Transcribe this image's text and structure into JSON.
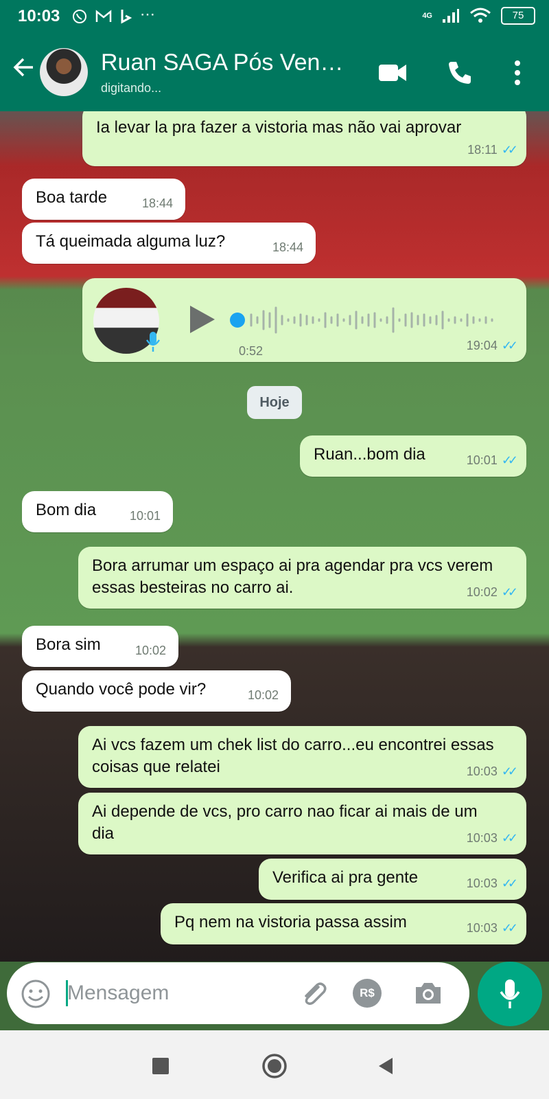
{
  "status_bar": {
    "time": "10:03",
    "network": "4G",
    "battery": "75"
  },
  "header": {
    "contact_name": "Ruan SAGA Pós Ven…",
    "status": "digitando..."
  },
  "messages": [
    {
      "dir": "out",
      "text": "Ia levar la pra fazer a vistoria mas não vai aprovar",
      "time": "18:11"
    },
    {
      "dir": "in",
      "text": "Boa tarde",
      "time": "18:44"
    },
    {
      "dir": "in",
      "text": "Tá queimada alguma luz?",
      "time": "18:44"
    },
    {
      "dir": "out",
      "type": "voice",
      "duration": "0:52",
      "time": "19:04"
    },
    {
      "dir": "out",
      "text": "Ruan...bom dia",
      "time": "10:01"
    },
    {
      "dir": "in",
      "text": "Bom dia",
      "time": "10:01"
    },
    {
      "dir": "out",
      "text": "Bora arrumar um espaço ai pra agendar pra vcs verem essas besteiras no carro ai.",
      "time": "10:02"
    },
    {
      "dir": "in",
      "text": "Bora sim",
      "time": "10:02"
    },
    {
      "dir": "in",
      "text": "Quando você pode vir?",
      "time": "10:02"
    },
    {
      "dir": "out",
      "text": "Ai vcs fazem um chek list do carro...eu encontrei essas coisas que relatei",
      "time": "10:03"
    },
    {
      "dir": "out",
      "text": "Ai depende de vcs, pro carro nao ficar ai mais de um dia",
      "time": "10:03"
    },
    {
      "dir": "out",
      "text": "Verifica ai pra gente",
      "time": "10:03"
    },
    {
      "dir": "out",
      "text": "Pq nem na vistoria passa assim",
      "time": "10:03"
    }
  ],
  "day_separator": "Hoje",
  "composer": {
    "placeholder": "Mensagem",
    "payment_label": "R$"
  },
  "colors": {
    "header": "#00775e",
    "accent": "#00a884",
    "outgoing_bubble": "#dcf8c6",
    "incoming_bubble": "#ffffff",
    "read_ticks": "#34b7f1"
  },
  "icons": [
    "back-arrow-icon",
    "video-call-icon",
    "phone-icon",
    "more-vert-icon",
    "play-icon",
    "mic-icon",
    "emoji-icon",
    "attach-icon",
    "payment-icon",
    "camera-icon",
    "stop-icon",
    "home-icon",
    "back-nav-icon"
  ]
}
